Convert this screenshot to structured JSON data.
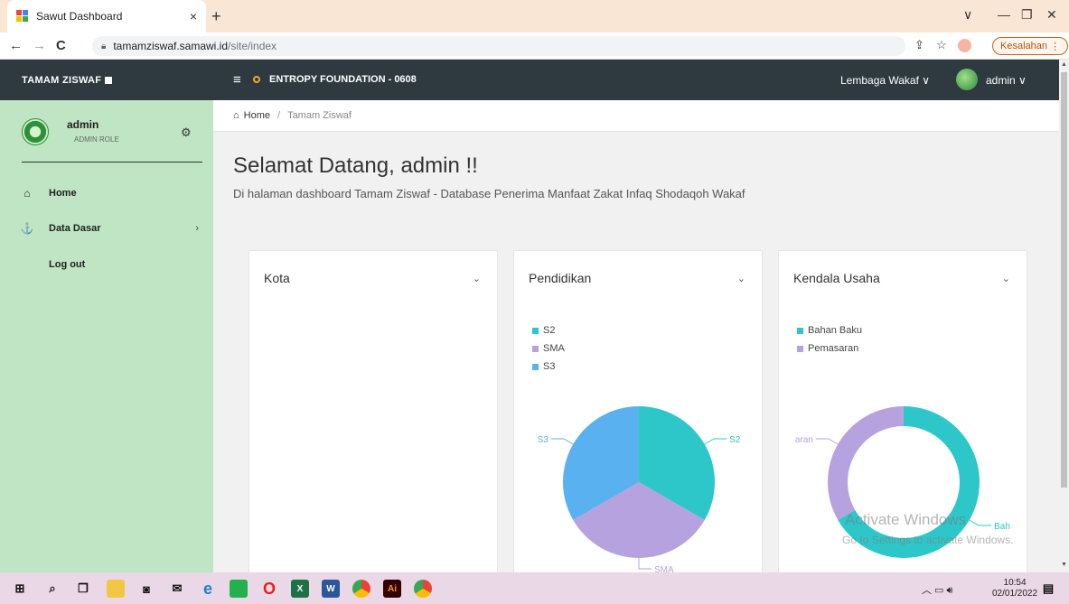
{
  "browser": {
    "tab_title": "Sawut Dashboard",
    "tab_close": "×",
    "new_tab": "+",
    "url_host": "tamamziswaf.samawi.id",
    "url_path": "/site/index",
    "profile_button": "Kesalahan",
    "profile_menu": "⋮",
    "back": "←",
    "forward": "→",
    "reload": "C",
    "share": "⇪",
    "star": "☆",
    "win_dropdown": "∨",
    "win_min": "—",
    "win_max": "❐",
    "win_close": "✕"
  },
  "header": {
    "brand": "TAMAM ZISWAF",
    "menu_icon": "≡",
    "org": "ENTROPY FOUNDATION - 0608",
    "lembaga": "Lembaga Wakaf ∨",
    "user": "admin ∨"
  },
  "sidebar": {
    "profile_name": "admin",
    "profile_role": "ADMIN ROLE",
    "items": [
      {
        "label": "Home",
        "icon": "home-icon",
        "glyph": "⌂"
      },
      {
        "label": "Data Dasar",
        "icon": "anchor-icon",
        "glyph": "⚓",
        "chevron": "›"
      },
      {
        "label": "Log out",
        "icon": "",
        "glyph": ""
      }
    ]
  },
  "breadcrumb": {
    "home": "Home",
    "separator": "/",
    "current": "Tamam Ziswaf"
  },
  "main": {
    "welcome": "Selamat Datang, admin !!",
    "subtitle": "Di halaman dashboard Tamam Ziswaf - Database Penerima Manfaat Zakat Infaq Shodaqoh Wakaf"
  },
  "cards": [
    {
      "title": "Kota",
      "chevron": "⌄"
    },
    {
      "title": "Pendidikan",
      "chevron": "⌄"
    },
    {
      "title": "Kendala Usaha",
      "chevron": "⌄"
    }
  ],
  "chart_data": [
    {
      "type": "pie",
      "title": "Pendidikan",
      "categories": [
        "S2",
        "SMA",
        "S3"
      ],
      "values": [
        1,
        1,
        1
      ],
      "colors": [
        "#2ec7c9",
        "#b6a2de",
        "#5ab1ef"
      ],
      "legend": "top-left"
    },
    {
      "type": "pie",
      "title": "Kendala Usaha",
      "categories": [
        "Bahan Baku",
        "Pemasaran"
      ],
      "values": [
        2,
        1
      ],
      "colors": [
        "#2ec7c9",
        "#b6a2de"
      ],
      "donut": true,
      "legend": "top-left",
      "visible_labels": [
        "aran",
        "Bah"
      ]
    }
  ],
  "watermark": {
    "line1": "Activate Windows",
    "line2": "Go to Settings to activate Windows."
  },
  "taskbar": {
    "time": "10:54",
    "date": "02/01/2022"
  },
  "colors": {
    "sidebar_bg": "#bfe5c4",
    "header_bg": "#2e3a3f",
    "accent_orange": "#f5a623"
  }
}
